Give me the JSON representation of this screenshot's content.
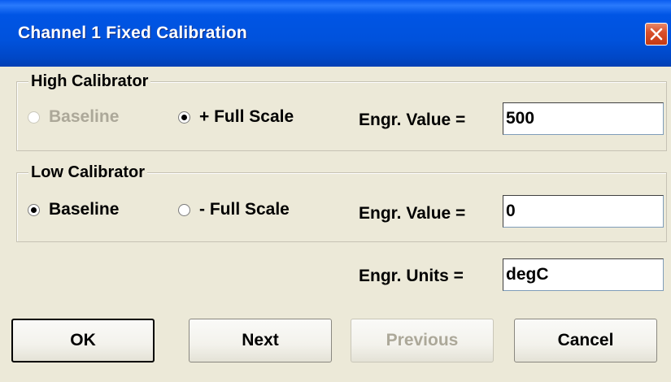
{
  "window": {
    "title": "Channel 1 Fixed Calibration"
  },
  "high_calibrator": {
    "legend": "High Calibrator",
    "baseline_label": "Baseline",
    "full_scale_label": "+ Full Scale",
    "selected": "full_scale",
    "baseline_disabled": true,
    "engr_value_label": "Engr. Value =",
    "engr_value": "500"
  },
  "low_calibrator": {
    "legend": "Low Calibrator",
    "baseline_label": "Baseline",
    "full_scale_label": "- Full Scale",
    "selected": "baseline",
    "engr_value_label": "Engr. Value =",
    "engr_value": "0"
  },
  "engr_units": {
    "label": "Engr. Units =",
    "value": "degC"
  },
  "buttons": {
    "ok": "OK",
    "next": "Next",
    "previous": "Previous",
    "previous_disabled": true,
    "cancel": "Cancel"
  },
  "colors": {
    "titlebar": "#0055e5",
    "dialog_bg": "#ece9d8",
    "disabled_text": "#aca899",
    "close_button": "#d9502c"
  },
  "icons": {
    "close": "close-icon"
  }
}
